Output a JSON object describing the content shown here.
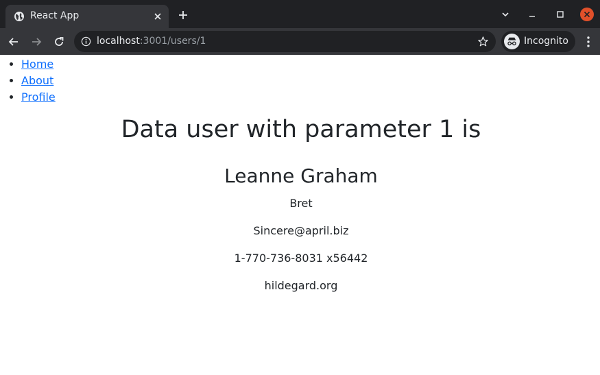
{
  "browser": {
    "tab_title": "React App",
    "url_host": "localhost",
    "url_path": ":3001/users/1",
    "incognito_label": "Incognito",
    "colors": {
      "chrome_dark": "#202124",
      "chrome_tab": "#35363a",
      "close_red": "#e0502a"
    }
  },
  "nav": {
    "links": [
      "Home",
      "About",
      "Profile"
    ],
    "link_color": "#0d6efd"
  },
  "page": {
    "title": "Data user with parameter 1 is",
    "user": {
      "name": "Leanne Graham",
      "username": "Bret",
      "email": "Sincere@april.biz",
      "phone": "1-770-736-8031 x56442",
      "website": "hildegard.org"
    }
  }
}
